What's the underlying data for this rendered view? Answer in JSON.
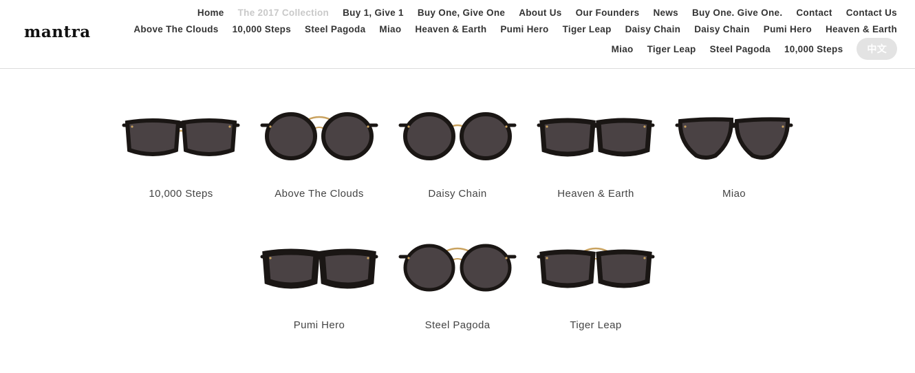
{
  "brand": {
    "logo": "mantra"
  },
  "nav": {
    "row1": [
      "Home",
      "The 2017 Collection",
      "Buy 1, Give 1",
      "Buy One, Give One",
      "About Us",
      "Our Founders",
      "News",
      "Buy One. Give One.",
      "Contact",
      "Contact Us"
    ],
    "row2": [
      "Above The Clouds",
      "10,000 Steps",
      "Steel Pagoda",
      "Miao",
      "Heaven & Earth",
      "Pumi Hero",
      "Tiger Leap",
      "Daisy Chain",
      "Daisy Chain",
      "Pumi Hero",
      "Heaven & Earth"
    ],
    "row3": [
      "Miao",
      "Tiger Leap",
      "Steel Pagoda",
      "10,000 Steps"
    ],
    "active_index_row1": 1,
    "language_button": "中文"
  },
  "products": {
    "row1": [
      {
        "name": "10,000 Steps",
        "style": "browline"
      },
      {
        "name": "Above The Clouds",
        "style": "cateye-bridge"
      },
      {
        "name": "Daisy Chain",
        "style": "round"
      },
      {
        "name": "Heaven & Earth",
        "style": "square"
      },
      {
        "name": "Miao",
        "style": "cateye"
      }
    ],
    "row2": [
      {
        "name": "Pumi Hero",
        "style": "square-thick"
      },
      {
        "name": "Steel Pagoda",
        "style": "round-bridge"
      },
      {
        "name": "Tiger Leap",
        "style": "square-bridge"
      }
    ]
  },
  "colors": {
    "frame": "#1a1614",
    "lens": "#4a4244",
    "metal": "#c9a25f",
    "nav_active": "#c9c9c9",
    "lang_bg": "#e3e3e3"
  }
}
